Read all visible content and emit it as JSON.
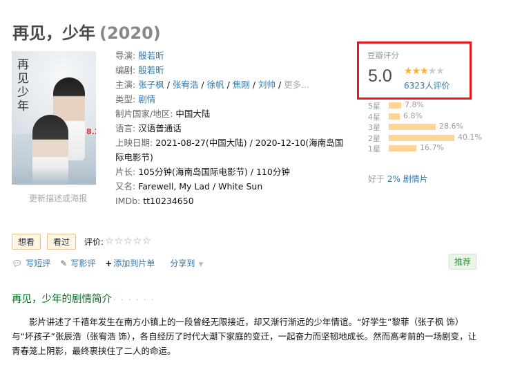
{
  "movie": {
    "title": "再见，少年",
    "year": "(2020)"
  },
  "poster": {
    "calligraphy": "再见少年",
    "date_text": "8.27",
    "update_link": "更新描述或海报"
  },
  "info": {
    "director_label": "导演:",
    "director": "殷若昕",
    "writer_label": "编剧:",
    "writer": "殷若昕",
    "cast_label": "主演:",
    "cast": [
      "张子枫",
      "张宥浩",
      "徐帆",
      "焦刚",
      "刘帅"
    ],
    "cast_more": "更多...",
    "genre_label": "类型:",
    "genre": "剧情",
    "country_label": "制片国家/地区:",
    "country": "中国大陆",
    "language_label": "语言:",
    "language": "汉语普通话",
    "release_label": "上映日期:",
    "release": "2021-08-27(中国大陆) / 2020-12-10(海南岛国际电影节)",
    "runtime_label": "片长:",
    "runtime": "105分钟(海南岛国际电影节) / 110分钟",
    "aka_label": "又名:",
    "aka": "Farewell, My Lad / White Sun",
    "imdb_label": "IMDb:",
    "imdb": "tt10234650"
  },
  "rating": {
    "title": "豆瓣评分",
    "score": "5.0",
    "stars": 2.5,
    "count": "6323人评价",
    "highlight_color": "#e5191f",
    "distribution": [
      {
        "label": "5星",
        "pct": "7.8%",
        "value": 7.8
      },
      {
        "label": "4星",
        "pct": "6.8%",
        "value": 6.8
      },
      {
        "label": "3星",
        "pct": "28.6%",
        "value": 28.6
      },
      {
        "label": "2星",
        "pct": "40.1%",
        "value": 40.1
      },
      {
        "label": "1星",
        "pct": "16.7%",
        "value": 16.7
      }
    ],
    "better_than_prefix": "好于",
    "better_than_link": "2% 剧情片"
  },
  "actions": {
    "want": "想看",
    "seen": "看过",
    "rate_label": "评价:",
    "write_short": "写短评",
    "write_review": "写影评",
    "add_list": "添加到片单",
    "share": "分享到",
    "recommend": "推荐"
  },
  "synopsis": {
    "heading": "再见，少年的剧情简介",
    "heading_dots": "· · · · · ·",
    "text": "影片讲述了千禧年发生在南方小镇上的一段曾经无限接近，却又渐行渐远的少年情谊。“好学生”黎菲（张子枫 饰）与“坏孩子”张辰浩（张宥浩 饰），各自经历了时代大潮下家庭的变迁，一起奋力而坚韧地成长。然而高考前的一场剧变，让青春笼上阴影，最终裹挟住了二人的命运。"
  },
  "colors": {
    "link": "#3377aa",
    "section_green": "#007722",
    "star": "#ffac2d",
    "bar": "#ffd596"
  }
}
